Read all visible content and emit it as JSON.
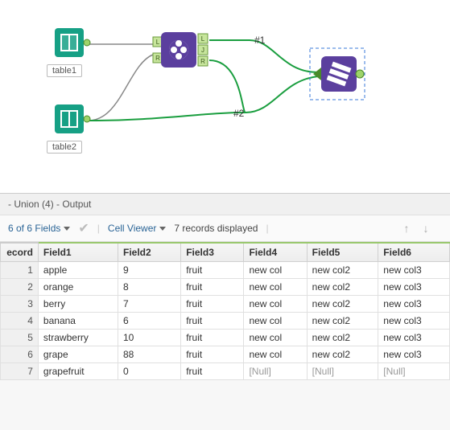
{
  "canvas": {
    "nodes": {
      "table1_label": "table1",
      "table2_label": "table2"
    },
    "annotations": {
      "branch1": "#1",
      "branch2": "#2"
    },
    "join_anchors": {
      "L": "L",
      "J": "J",
      "R": "R"
    }
  },
  "results": {
    "header": " - Union (4) - Output",
    "toolbar": {
      "fields_summary": "6 of 6 Fields",
      "cell_viewer_label": "Cell Viewer",
      "records_text": "7 records displayed"
    },
    "columns": [
      "ecord",
      "Field1",
      "Field2",
      "Field3",
      "Field4",
      "Field5",
      "Field6"
    ],
    "rows": [
      {
        "n": 1,
        "c": [
          "apple",
          "9",
          "fruit",
          "new col",
          "new col2",
          "new col3"
        ]
      },
      {
        "n": 2,
        "c": [
          "orange",
          "8",
          "fruit",
          "new col",
          "new col2",
          "new col3"
        ]
      },
      {
        "n": 3,
        "c": [
          "berry",
          "7",
          "fruit",
          "new col",
          "new col2",
          "new col3"
        ]
      },
      {
        "n": 4,
        "c": [
          "banana",
          "6",
          "fruit",
          "new col",
          "new col2",
          "new col3"
        ]
      },
      {
        "n": 5,
        "c": [
          "strawberry",
          "10",
          "fruit",
          "new col",
          "new col2",
          "new col3"
        ]
      },
      {
        "n": 6,
        "c": [
          "grape",
          "88",
          "fruit",
          "new col",
          "new col2",
          "new col3"
        ]
      },
      {
        "n": 7,
        "c": [
          "grapefruit",
          "0",
          "fruit",
          "[Null]",
          "[Null]",
          "[Null]"
        ]
      }
    ]
  }
}
